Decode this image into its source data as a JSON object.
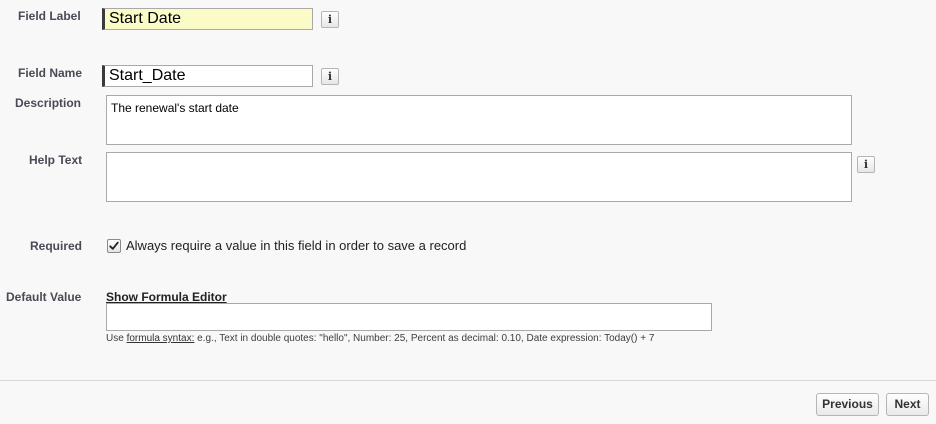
{
  "fields": {
    "field_label": {
      "label": "Field Label",
      "value": "Start Date",
      "info_icon": "info-icon"
    },
    "field_name": {
      "label": "Field Name",
      "value": "Start_Date",
      "info_icon": "info-icon"
    },
    "description": {
      "label": "Description",
      "value": "The renewal's start date"
    },
    "help_text": {
      "label": "Help Text",
      "value": "",
      "info_icon": "info-icon"
    },
    "required": {
      "label": "Required",
      "checked": true,
      "text": "Always require a value in this field in order to save a record"
    },
    "default_value": {
      "label": "Default Value",
      "editor_link": "Show Formula Editor",
      "value": "",
      "hint_prefix": "Use ",
      "hint_link": "formula syntax:",
      "hint_suffix": " e.g., Text in double quotes: \"hello\", Number: 25, Percent as decimal: 0.10, Date expression: Today() + 7"
    }
  },
  "info_glyph": "i",
  "buttons": {
    "previous": "Previous",
    "next": "Next"
  },
  "colors": {
    "highlight_input": "#fbfbc8",
    "required_bar": "#3a3a3a",
    "background": "#f8f8f8"
  }
}
